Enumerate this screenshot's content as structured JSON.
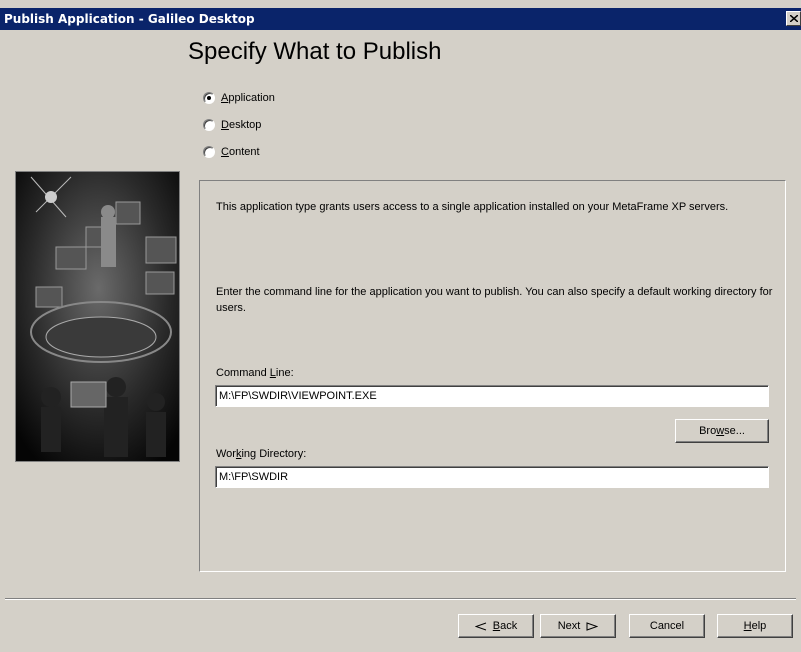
{
  "window": {
    "title": "Publish Application - Galileo Desktop"
  },
  "page": {
    "heading": "Specify What to Publish"
  },
  "publish_type": {
    "options": [
      {
        "prefix": "",
        "accel": "A",
        "rest": "pplication",
        "checked": true
      },
      {
        "prefix": "",
        "accel": "D",
        "rest": "esktop",
        "checked": false
      },
      {
        "prefix": "",
        "accel": "C",
        "rest": "ontent",
        "checked": false
      }
    ]
  },
  "details": {
    "description": "This application type grants users access to a single application installed on your MetaFrame XP servers.",
    "instruction": "Enter the command line for the application you want to publish.  You can also specify a default working directory for users.",
    "command_line": {
      "label_prefix": "Command ",
      "label_accel": "L",
      "label_suffix": "ine:",
      "value": "M:\\FP\\SWDIR\\VIEWPOINT.EXE"
    },
    "browse": {
      "prefix": "Bro",
      "accel": "w",
      "suffix": "se..."
    },
    "working_directory": {
      "label_prefix": "Wor",
      "label_accel": "k",
      "label_suffix": "ing Directory:",
      "value": "M:\\FP\\SWDIR"
    }
  },
  "footer": {
    "back": {
      "accel": "B",
      "rest": "ack"
    },
    "next": {
      "text": "Next"
    },
    "cancel": {
      "text": "Cancel"
    },
    "help": {
      "accel": "H",
      "rest": "elp"
    }
  },
  "colors": {
    "titlebar": "#0a246a",
    "face": "#d4d0c8"
  }
}
